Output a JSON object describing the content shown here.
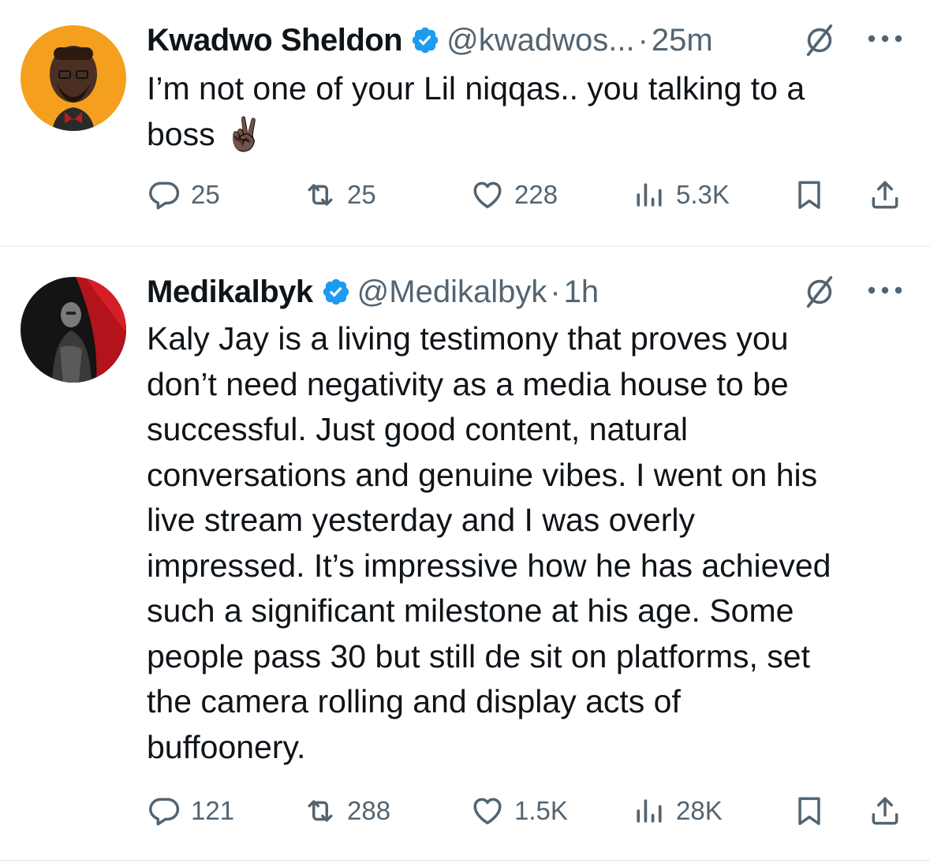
{
  "tweets": [
    {
      "display_name": "Kwadwo Sheldon",
      "handle": "@kwadwos...",
      "separator": "·",
      "time": "25m",
      "text_lines": [
        "I’m not one of your Lil niqqas.. you talking to a",
        "boss ✌🏿"
      ],
      "avatar_description": "cartoon-avatar-orange",
      "stats": {
        "replies": "25",
        "retweets": "25",
        "likes": "228",
        "views": "5.3K"
      }
    },
    {
      "display_name": "Medikalbyk",
      "handle": "@Medikalbyk",
      "separator": "·",
      "time": "1h",
      "text_lines": [
        "Kaly Jay is a living testimony that proves you",
        "don’t need negativity as a media house to be",
        "successful. Just good content, natural",
        "conversations and genuine vibes. I went on his",
        "live stream yesterday and I was overly",
        "impressed. It’s impressive how he has achieved",
        "such a significant milestone at his age. Some",
        "people pass 30 but still de sit on platforms, set",
        "the camera rolling and display acts of",
        "buffoonery."
      ],
      "avatar_description": "photo-avatar-red-dark",
      "stats": {
        "replies": "121",
        "retweets": "288",
        "likes": "1.5K",
        "views": "28K"
      }
    }
  ],
  "colors": {
    "text": "#0f1419",
    "muted": "#536471",
    "verified": "#1d9bf0",
    "divider": "#eff3f4"
  },
  "icons": [
    "verified-badge-icon",
    "grok-icon",
    "more-icon",
    "reply-icon",
    "retweet-icon",
    "like-icon",
    "views-icon",
    "bookmark-icon",
    "share-icon"
  ]
}
